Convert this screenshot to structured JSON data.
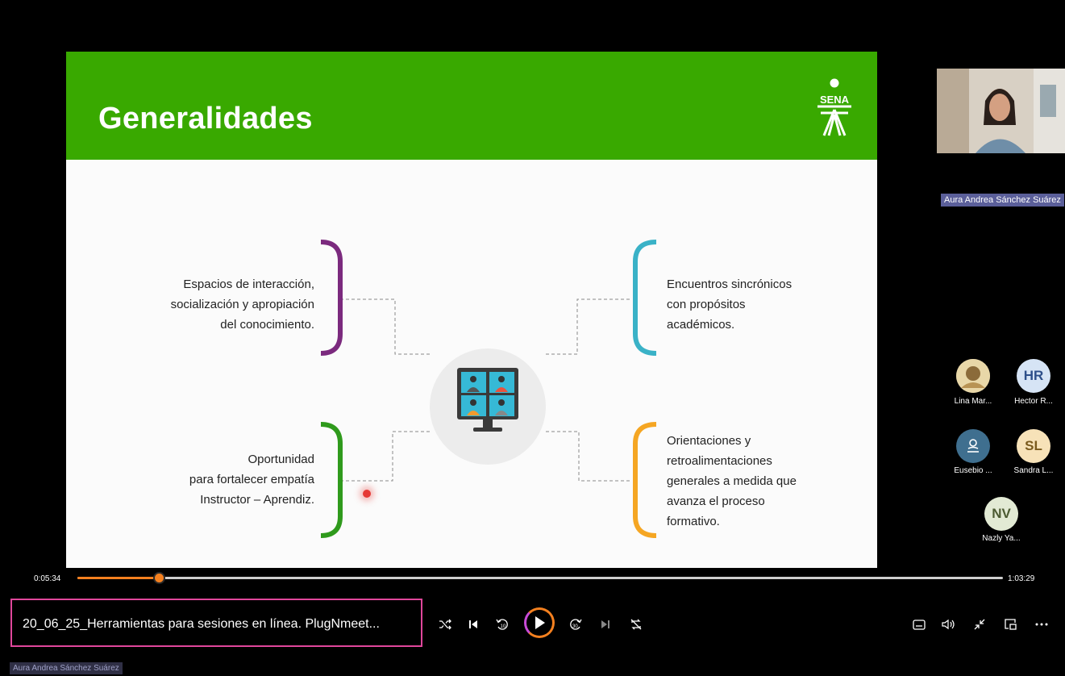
{
  "slide": {
    "title": "Generalidades",
    "logo_text": "SENA",
    "items": [
      {
        "lines": [
          "Espacios de interacción,",
          "socialización y apropiación",
          "del conocimiento."
        ],
        "color": "#7b2a7e"
      },
      {
        "lines": [
          "Encuentros sincrónicos",
          "con propósitos",
          "académicos."
        ],
        "color": "#3ab2c7"
      },
      {
        "lines": [
          "Oportunidad",
          "para fortalecer empatía",
          "Instructor – Aprendiz."
        ],
        "color": "#2f9a1c"
      },
      {
        "lines": [
          "Orientaciones y",
          "retroalimentaciones",
          "generales a medida que",
          "avanza el proceso",
          "formativo."
        ],
        "color": "#f5a623"
      }
    ],
    "center_icon": "video-conference-monitor-icon"
  },
  "participants": {
    "presenter_name": "Aura Andrea Sánchez Suárez",
    "people": [
      {
        "initials": "",
        "name": "Lina Mar...",
        "bg": "#d9c9a0",
        "fg": "#5a4b2b",
        "icon": "photo-avatar"
      },
      {
        "initials": "HR",
        "name": "Hector R...",
        "bg": "#d6e4f5",
        "fg": "#2d4f8a"
      },
      {
        "initials": "",
        "name": "Eusebio ...",
        "bg": "#3f6f8f",
        "fg": "#ffffff",
        "icon": "person-icon"
      },
      {
        "initials": "SL",
        "name": "Sandra L...",
        "bg": "#f7e2b8",
        "fg": "#7a5a1c"
      },
      {
        "initials": "NV",
        "name": "Nazly Ya...",
        "bg": "#e2ead4",
        "fg": "#4c5b32"
      }
    ]
  },
  "player": {
    "current_time": "0:05:34",
    "total_time": "1:03:29",
    "progress": 0.088,
    "file_title": "20_06_25_Herramientas para sesiones en línea. PlugNmeet...",
    "buttons": [
      "shuffle-icon",
      "previous-icon",
      "rewind-10-icon",
      "play-icon",
      "forward-30-icon",
      "next-icon",
      "repeat-off-icon",
      "captions-icon",
      "volume-icon",
      "minimize-icon",
      "mini-player-icon",
      "more-icon"
    ]
  },
  "bottom_name_tag": "Aura Andrea Sánchez Suárez",
  "colors": {
    "accent": "#f4801f",
    "brand_green": "#39a900",
    "highlight": "#e0479b"
  }
}
